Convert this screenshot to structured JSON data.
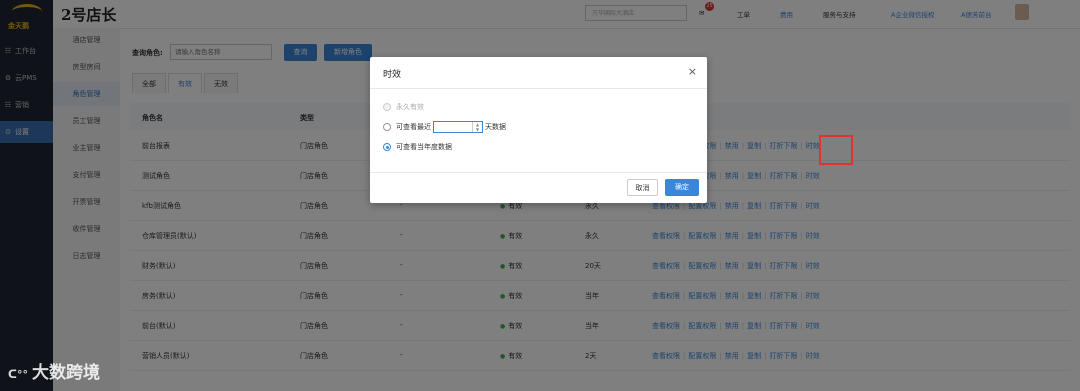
{
  "sidebar": {
    "logo_text": "金天鹅",
    "items": [
      {
        "label": "工作台",
        "icon": "grid-icon"
      },
      {
        "label": "云PMS",
        "icon": "gear-icon"
      },
      {
        "label": "营销",
        "icon": "grid-icon"
      },
      {
        "label": "设置",
        "icon": "gear-icon"
      }
    ]
  },
  "subnav": {
    "items": [
      "酒店管理",
      "房型房间",
      "角色管理",
      "员工管理",
      "业主管理",
      "支付管理",
      "开票管理",
      "收件管理",
      "日志管理"
    ]
  },
  "topbar": {
    "brand": "2号店长",
    "store_placeholder": "万华国际大酒店",
    "message_count": "25",
    "work_order": "工单",
    "fees": "费用",
    "service": "服务与支持",
    "wechat_auth": "A企业微信授权",
    "user": "A德芳前台"
  },
  "query": {
    "label": "查询角色:",
    "placeholder": "请输入角色名称",
    "search_button": "查询",
    "add_button": "新增角色"
  },
  "tabs": [
    "全部",
    "有效",
    "无效"
  ],
  "table": {
    "headers": [
      "角色名",
      "类型"
    ],
    "rows": [
      {
        "name": "前台报表",
        "type": "门店角色",
        "desc": "",
        "status": "",
        "validity": ""
      },
      {
        "name": "测试角色",
        "type": "门店角色",
        "desc": "",
        "status": "",
        "validity": ""
      },
      {
        "name": "kfb测试角色",
        "type": "门店角色",
        "desc": "-",
        "status": "有效",
        "validity": "永久"
      },
      {
        "name": "仓库管理员(默认)",
        "type": "门店角色",
        "desc": "-",
        "status": "有效",
        "validity": "永久"
      },
      {
        "name": "财务(默认)",
        "type": "门店角色",
        "desc": "-",
        "status": "有效",
        "validity": "20天"
      },
      {
        "name": "房务(默认)",
        "type": "门店角色",
        "desc": "-",
        "status": "有效",
        "validity": "当年"
      },
      {
        "name": "前台(默认)",
        "type": "门店角色",
        "desc": "-",
        "status": "有效",
        "validity": "当年"
      },
      {
        "name": "营销人员(默认)",
        "type": "门店角色",
        "desc": "-",
        "status": "有效",
        "validity": "2天"
      }
    ],
    "actions": [
      "查看权限",
      "配置权限",
      "禁用",
      "复制",
      "打折下限",
      "时效"
    ]
  },
  "modal": {
    "title": "时效",
    "close": "×",
    "options": {
      "forever": "永久有效",
      "recent_prefix": "可查看最近",
      "recent_suffix": "天数据",
      "current_year": "可查看当年度数据"
    },
    "selected": "current_year",
    "cancel": "取消",
    "confirm": "确定"
  },
  "watermark": "大数跨境",
  "colors": {
    "primary": "#3a86d9",
    "sidebar_bg": "#1e2532",
    "highlight": "#e0322f",
    "status_ok": "#36b24a"
  }
}
